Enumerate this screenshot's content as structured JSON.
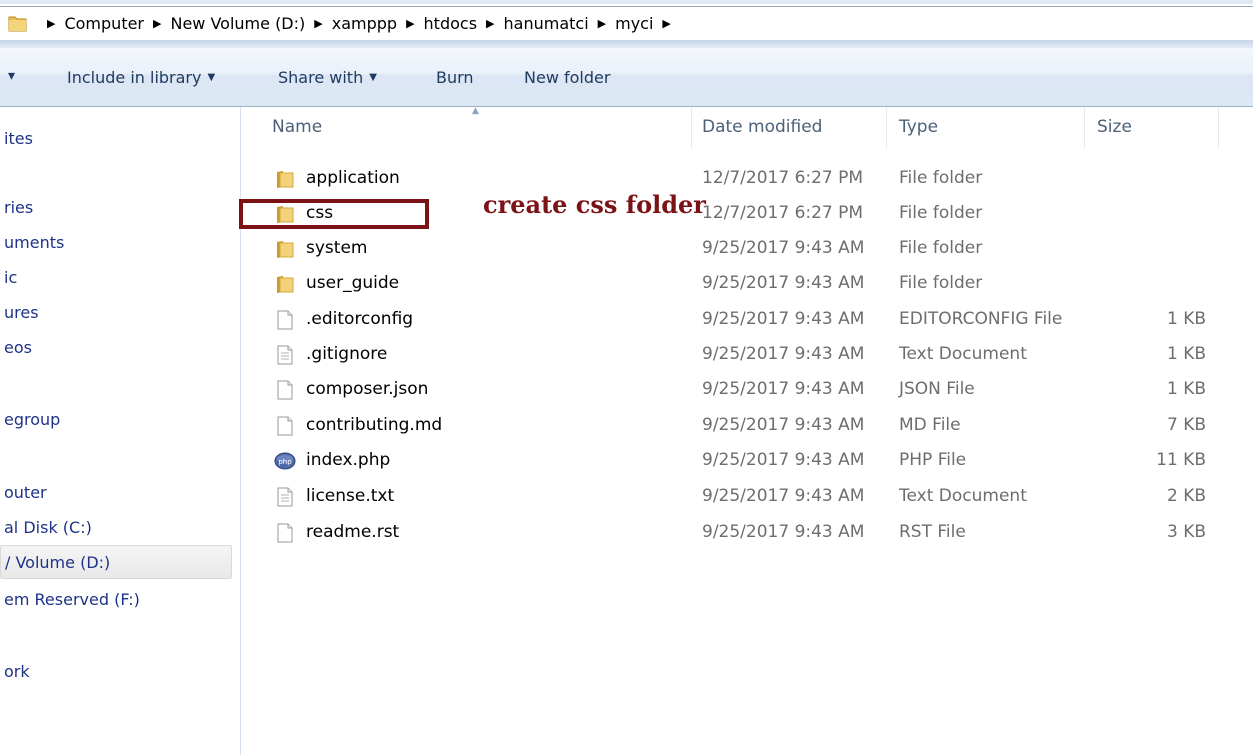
{
  "address_bar": {
    "crumbs": [
      "Computer",
      "New Volume (D:)",
      "xamppp",
      "htdocs",
      "hanumatci",
      "myci"
    ]
  },
  "toolbar": {
    "organize_caret": "▾",
    "include_in_library": "Include in library",
    "share_with": "Share with",
    "burn": "Burn",
    "new_folder": "New folder"
  },
  "sidebar": {
    "items": [
      {
        "label": "ites"
      },
      {
        "label": "ries"
      },
      {
        "label": "uments"
      },
      {
        "label": "ic"
      },
      {
        "label": "ures"
      },
      {
        "label": "eos"
      },
      {
        "label": "egroup"
      },
      {
        "label": "outer"
      },
      {
        "label": "al Disk (C:)"
      },
      {
        "label": "/ Volume (D:)",
        "selected": true
      },
      {
        "label": "em Reserved (F:)"
      },
      {
        "label": "ork"
      }
    ]
  },
  "columns": {
    "name": "Name",
    "date_modified": "Date modified",
    "type": "Type",
    "size": "Size"
  },
  "files": [
    {
      "name": "application",
      "date": "12/7/2017 6:27 PM",
      "type": "File folder",
      "size": "",
      "icon": "folder-icon"
    },
    {
      "name": "css",
      "date": "12/7/2017 6:27 PM",
      "type": "File folder",
      "size": "",
      "icon": "folder-icon"
    },
    {
      "name": "system",
      "date": "9/25/2017 9:43 AM",
      "type": "File folder",
      "size": "",
      "icon": "folder-icon"
    },
    {
      "name": "user_guide",
      "date": "9/25/2017 9:43 AM",
      "type": "File folder",
      "size": "",
      "icon": "folder-icon"
    },
    {
      "name": ".editorconfig",
      "date": "9/25/2017 9:43 AM",
      "type": "EDITORCONFIG File",
      "size": "1 KB",
      "icon": "file-icon"
    },
    {
      "name": ".gitignore",
      "date": "9/25/2017 9:43 AM",
      "type": "Text Document",
      "size": "1 KB",
      "icon": "text-file-icon"
    },
    {
      "name": "composer.json",
      "date": "9/25/2017 9:43 AM",
      "type": "JSON File",
      "size": "1 KB",
      "icon": "file-icon"
    },
    {
      "name": "contributing.md",
      "date": "9/25/2017 9:43 AM",
      "type": "MD File",
      "size": "7 KB",
      "icon": "file-icon"
    },
    {
      "name": "index.php",
      "date": "9/25/2017 9:43 AM",
      "type": "PHP File",
      "size": "11 KB",
      "icon": "php-file-icon"
    },
    {
      "name": "license.txt",
      "date": "9/25/2017 9:43 AM",
      "type": "Text Document",
      "size": "2 KB",
      "icon": "text-file-icon"
    },
    {
      "name": "readme.rst",
      "date": "9/25/2017 9:43 AM",
      "type": "RST File",
      "size": "3 KB",
      "icon": "file-icon"
    }
  ],
  "annotation": {
    "text": "create css folder",
    "color": "#7b1216"
  }
}
